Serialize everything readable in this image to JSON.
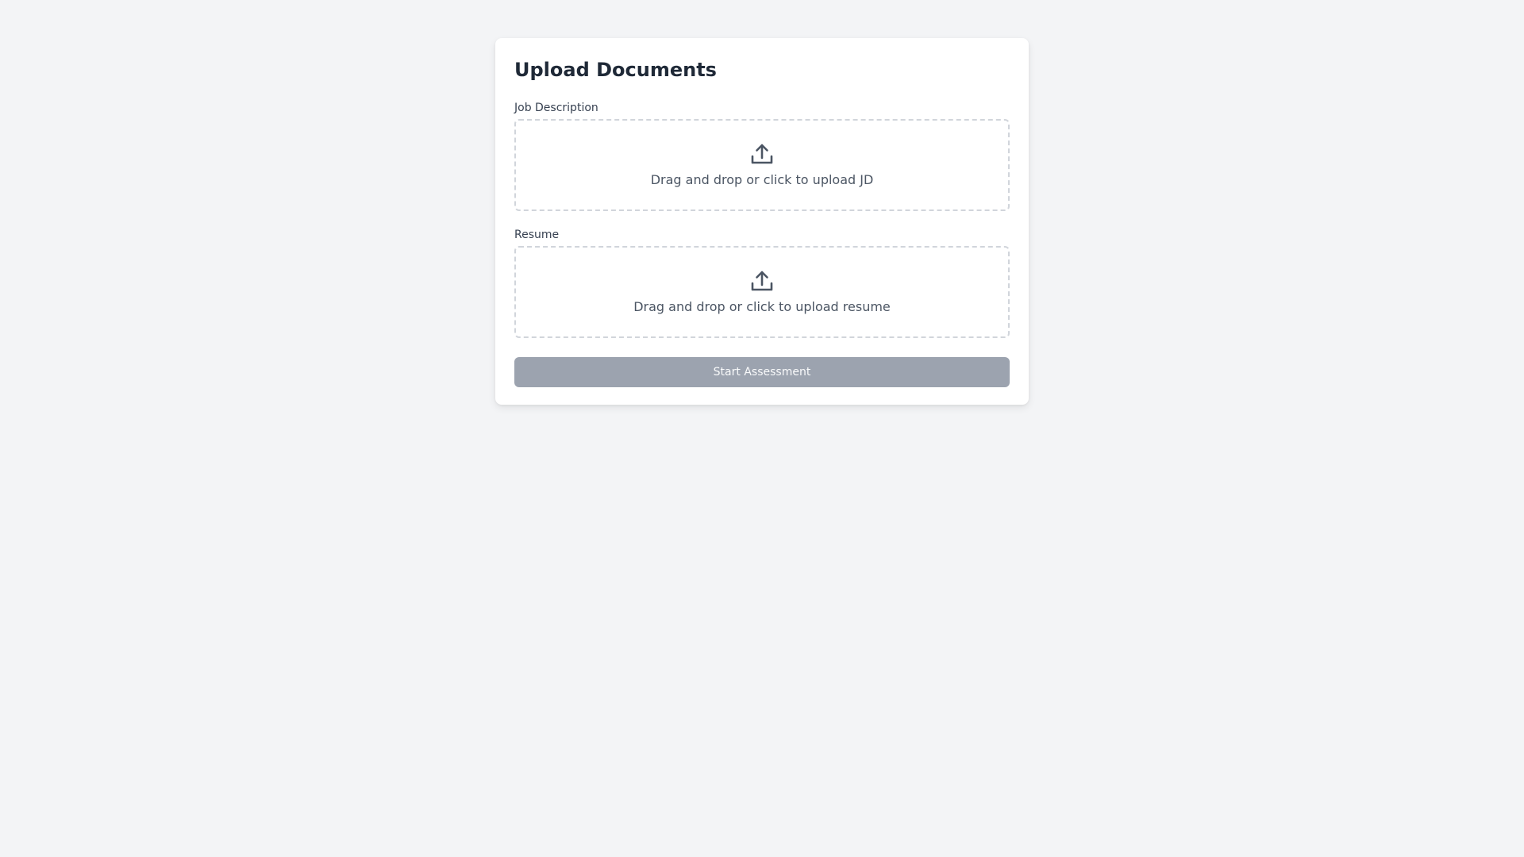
{
  "upload": {
    "title": "Upload Documents",
    "job_description": {
      "label": "Job Description",
      "hint": "Drag and drop or click to upload JD",
      "icon": "upload-icon"
    },
    "resume": {
      "label": "Resume",
      "hint": "Drag and drop or click to upload resume",
      "icon": "upload-icon"
    },
    "start_button": {
      "label": "Start Assessment",
      "state": "disabled"
    }
  },
  "colors": {
    "background": "#f3f4f6",
    "card": "#ffffff",
    "title": "#1f2937",
    "dropzone_border": "#d1d5db",
    "hint_text": "#4b5563",
    "button_disabled": "#9ca3af"
  }
}
